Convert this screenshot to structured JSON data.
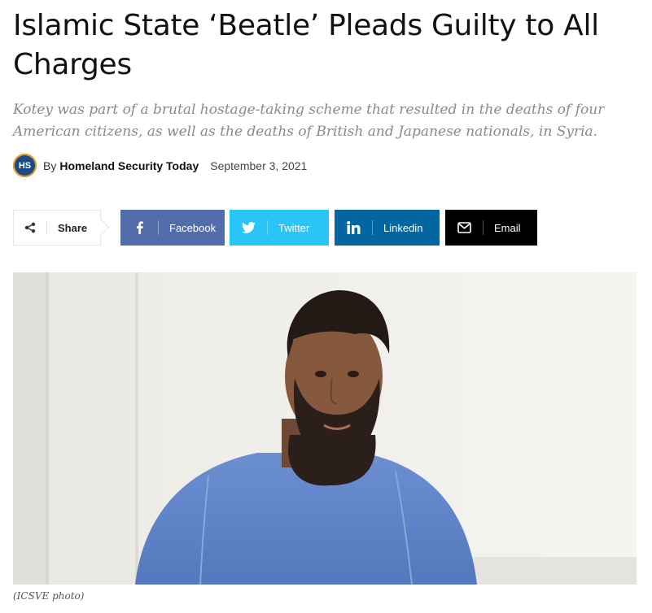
{
  "article": {
    "title": "Islamic State ‘Beatle’ Pleads Guilty to All Charges",
    "subtitle": "Kotey was part of a brutal hostage-taking scheme that resulted in the deaths of four American citizens, as well as the deaths of British and Japanese nationals, in Syria.",
    "byline_prefix": "By",
    "author": "Homeland Security Today",
    "author_avatar_text": "HS",
    "date": "September 3, 2021",
    "photo_caption": "(ICSVE photo)"
  },
  "share": {
    "label": "Share",
    "icon": "share-icon",
    "buttons": [
      {
        "label": "Facebook",
        "icon": "facebook-icon",
        "color": "#516eab"
      },
      {
        "label": "Twitter",
        "icon": "twitter-icon",
        "color": "#29c5f6"
      },
      {
        "label": "Linkedin",
        "icon": "linkedin-icon",
        "color": "#0266a0"
      },
      {
        "label": "Email",
        "icon": "email-icon",
        "color": "#000000"
      }
    ]
  },
  "colors": {
    "title": "#111111",
    "subtitle": "#8a8a8a",
    "avatar_bg": "#1a4a8a",
    "avatar_ring": "#f39a1e"
  }
}
